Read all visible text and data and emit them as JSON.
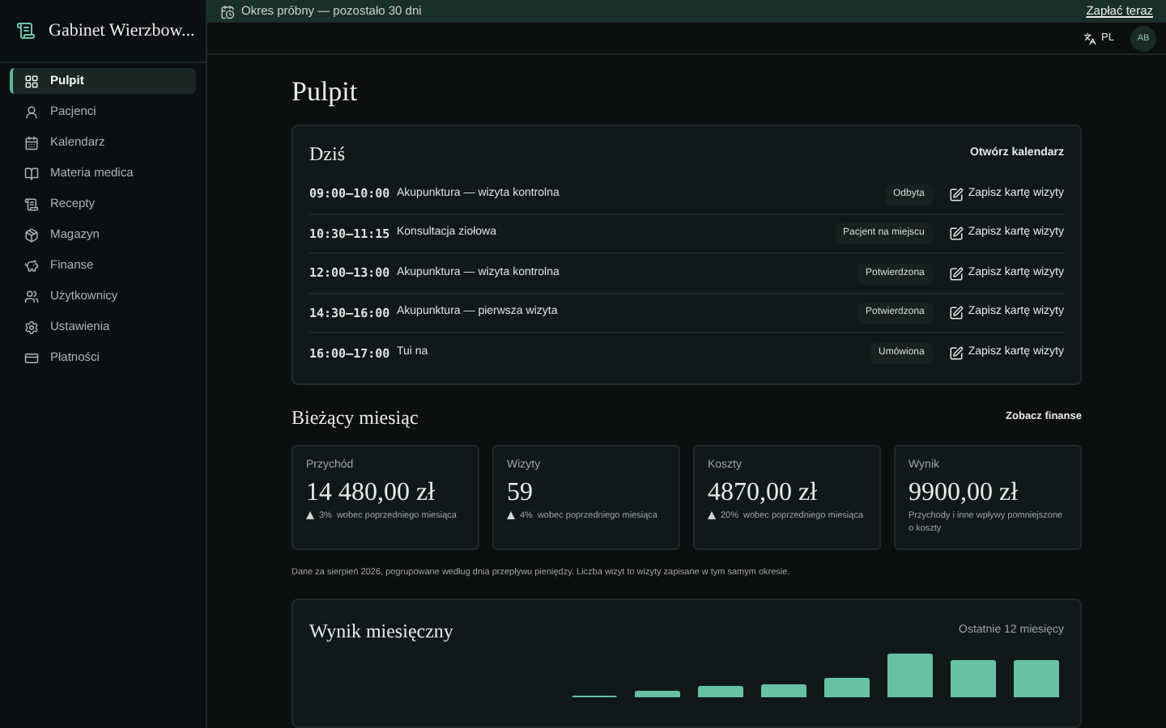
{
  "app": {
    "title": "Gabinet Wierzbow..."
  },
  "sidebar": {
    "items": [
      {
        "label": "Pulpit",
        "selected": true
      },
      {
        "label": "Pacjenci",
        "selected": false
      },
      {
        "label": "Kalendarz",
        "selected": false
      },
      {
        "label": "Materia medica",
        "selected": false
      },
      {
        "label": "Recepty",
        "selected": false
      },
      {
        "label": "Magazyn",
        "selected": false
      },
      {
        "label": "Finanse",
        "selected": false
      },
      {
        "label": "Użytkownicy",
        "selected": false
      },
      {
        "label": "Ustawienia",
        "selected": false
      },
      {
        "label": "Płatności",
        "selected": false
      }
    ]
  },
  "banner": {
    "text": "Okres próbny — pozostało 30 dni",
    "action": "Zapłać teraz"
  },
  "header": {
    "language": "PL",
    "avatar": "AB"
  },
  "page_title": "Pulpit",
  "today": {
    "title": "Dziś",
    "action": "Otwórz kalendarz",
    "rows": [
      {
        "time": "09:00–10:00",
        "title": "Akupunktura — wizyta kontrolna",
        "status": "Odbyta",
        "action": "Zapisz kartę wizyty"
      },
      {
        "time": "10:30–11:15",
        "title": "Konsultacja ziołowa",
        "status": "Pacjent na miejscu",
        "action": "Zapisz kartę wizyty"
      },
      {
        "time": "12:00–13:00",
        "title": "Akupunktura — wizyta kontrolna",
        "status": "Potwierdzona",
        "action": "Zapisz kartę wizyty"
      },
      {
        "time": "14:30–16:00",
        "title": "Akupunktura — pierwsza wizyta",
        "status": "Potwierdzona",
        "action": "Zapisz kartę wizyty"
      },
      {
        "time": "16:00–17:00",
        "title": "Tui na",
        "status": "Umówiona",
        "action": "Zapisz kartę wizyty"
      }
    ]
  },
  "month": {
    "title": "Bieżący miesiąc",
    "action": "Zobacz finanse",
    "stats": [
      {
        "label": "Przychód",
        "value": "14 480,00 zł",
        "rising": true,
        "change": "3%",
        "change_note": "wobec poprzedniego miesiąca"
      },
      {
        "label": "Wizyty",
        "value": "59",
        "rising": true,
        "change": "4%",
        "change_note": "wobec poprzedniego miesiąca"
      },
      {
        "label": "Koszty",
        "value": "4870,00 zł",
        "rising": true,
        "change": "20%",
        "change_note": "wobec poprzedniego miesiąca"
      },
      {
        "label": "Wynik",
        "value": "9900,00 zł",
        "description": "Przychody i inne wpływy pomniejszone o koszty"
      }
    ],
    "note": "Dane za sierpień 2026, pogrupowane według dnia przepływu pieniędzy. Liczba wizyt to wizyty zapisane w tym samym okresie."
  },
  "chart": {
    "title": "Wynik miesięczny",
    "range": "Ostatnie 12 miesięcy"
  }
}
